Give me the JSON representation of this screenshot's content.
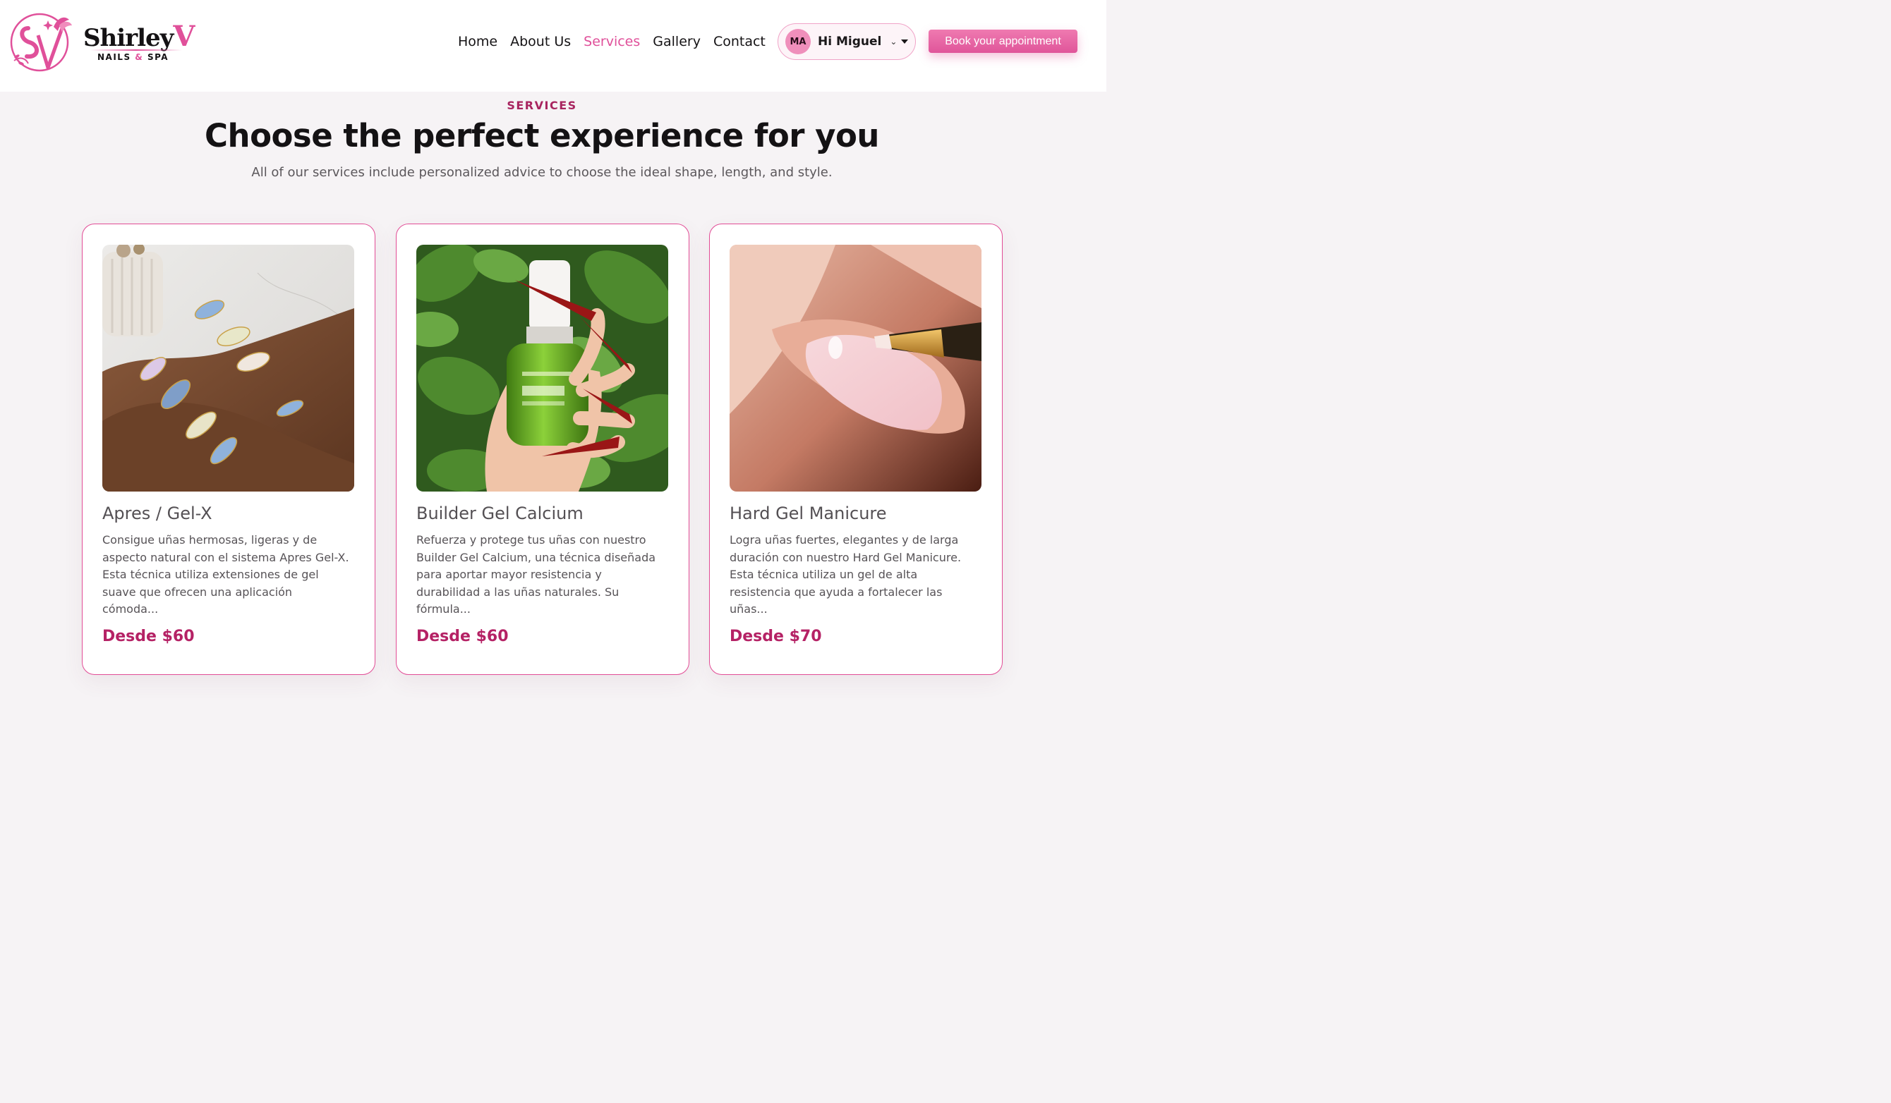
{
  "brand": {
    "name": "Shirley",
    "name_accent": "V",
    "tagline_left": "NAILS",
    "tagline_amp": "&",
    "tagline_right": "SPA",
    "accent_color": "#e0509a"
  },
  "nav": {
    "items": [
      {
        "label": "Home",
        "active": false
      },
      {
        "label": "About Us",
        "active": false
      },
      {
        "label": "Services",
        "active": true
      },
      {
        "label": "Gallery",
        "active": false
      },
      {
        "label": "Contact",
        "active": false
      }
    ]
  },
  "user": {
    "initials": "MA",
    "greeting": "Hi Miguel",
    "chevron": "chevron-down-icon"
  },
  "cta": {
    "label": "Book your appointment"
  },
  "hero": {
    "eyebrow": "SERVICES",
    "title": "Choose the perfect experience for you",
    "subtitle": "All of our services include personalized advice to choose the ideal shape, length, and style."
  },
  "services": [
    {
      "title": "Apres / Gel-X",
      "description": "Consigue uñas hermosas, ligeras y de aspecto natural con el sistema Apres Gel-X. Esta técnica utiliza extensiones de gel suave que ofrecen una aplicación cómoda...",
      "price": "Desde $60",
      "image": "argyle-nail-art-photo"
    },
    {
      "title": "Builder Gel Calcium",
      "description": "Refuerza y protege tus uñas con nuestro Builder Gel Calcium, una técnica diseñada para aportar mayor resistencia y durabilidad a las uñas naturales. Su fórmula...",
      "price": "Desde $60",
      "image": "builder-gel-bottle-photo"
    },
    {
      "title": "Hard Gel Manicure",
      "description": "Logra uñas fuertes, elegantes y de larga duración con nuestro Hard Gel Manicure. Esta técnica utiliza un gel de alta resistencia que ayuda a fortalecer las uñas...",
      "price": "Desde $70",
      "image": "hard-gel-application-photo"
    }
  ]
}
